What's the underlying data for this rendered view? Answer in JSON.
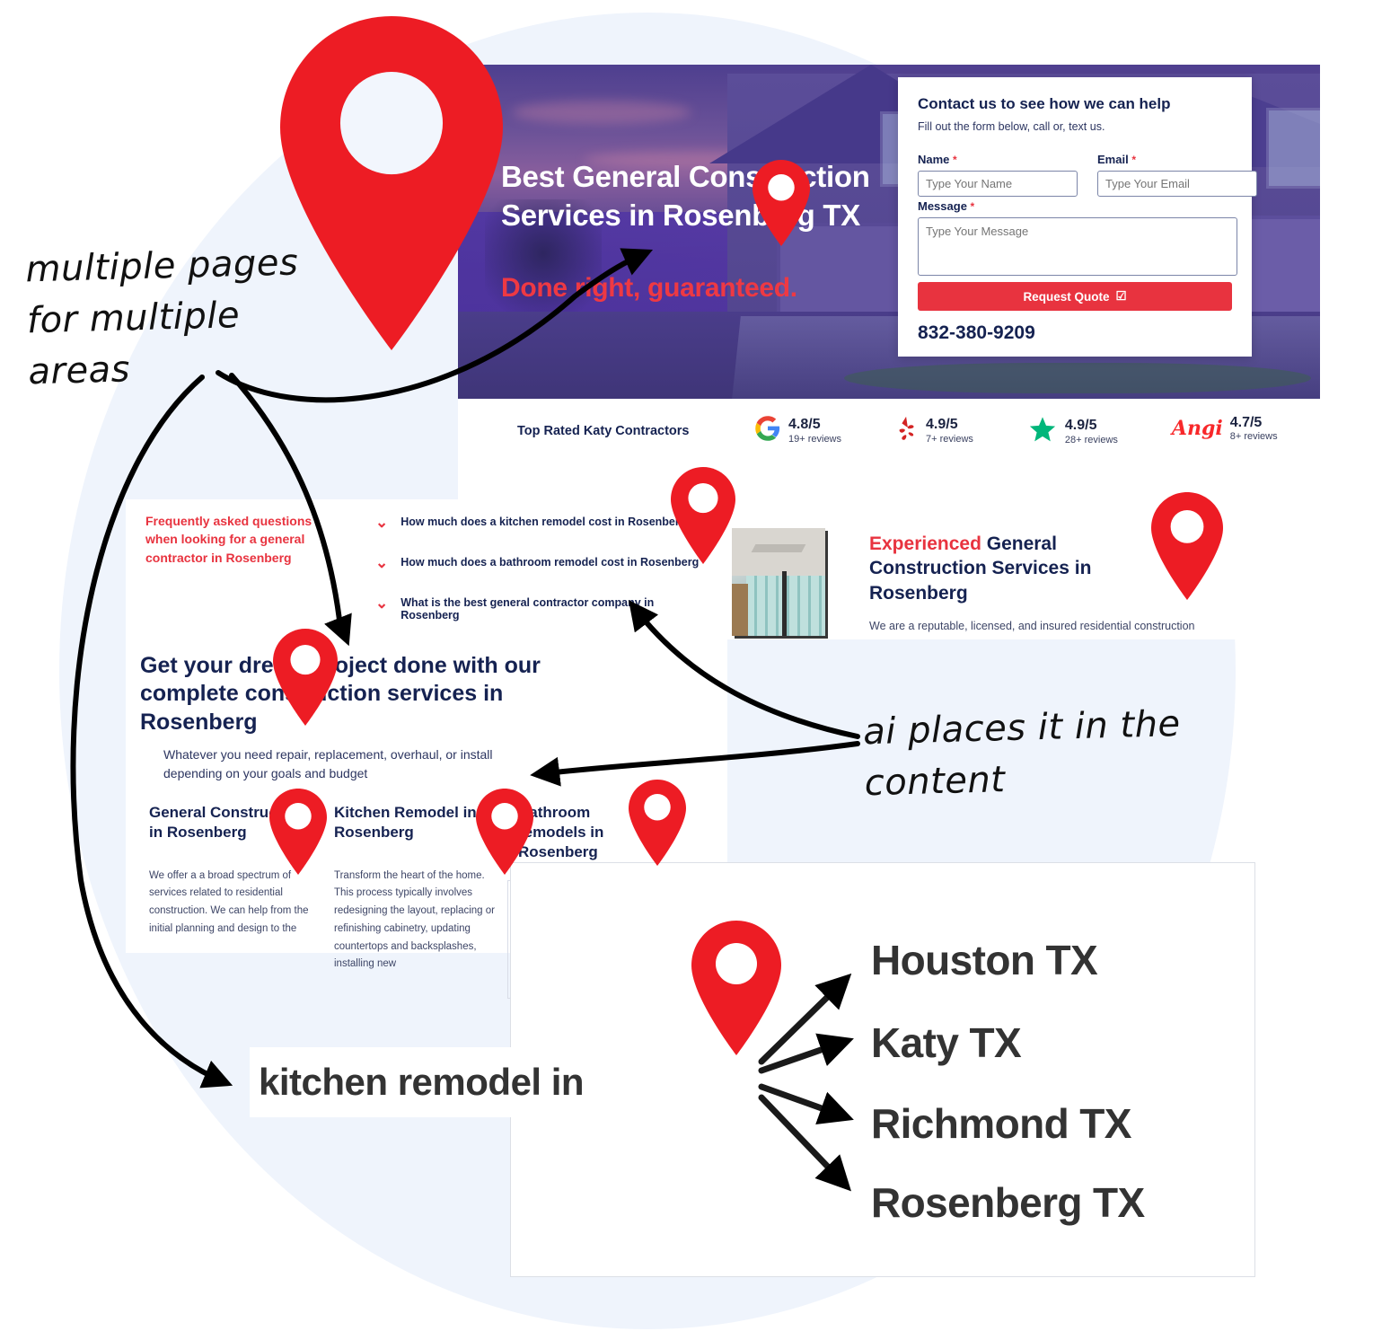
{
  "hero": {
    "title": "Best General Construction Services in Rosenberg TX",
    "subtitle": "Done right, guaranteed."
  },
  "form": {
    "title": "Contact us to see how we can help",
    "subtitle": "Fill out the form below, call or, text us.",
    "name_label": "Name",
    "name_placeholder": "Type Your Name",
    "email_label": "Email",
    "email_placeholder": "Type Your Email",
    "message_label": "Message",
    "message_placeholder": "Type Your Message",
    "required_mark": "*",
    "submit_label": "Request Quote",
    "submit_icon": "checkbox-icon",
    "phone": "832-380-9209"
  },
  "reviews": {
    "heading": "Top Rated Katy Contractors",
    "items": [
      {
        "platform": "google",
        "icon": "google-g-icon",
        "score": "4.8/5",
        "count": "19+ reviews"
      },
      {
        "platform": "yelp",
        "icon": "yelp-burst-icon",
        "score": "4.9/5",
        "count": "7+ reviews"
      },
      {
        "platform": "star",
        "icon": "green-star-icon",
        "score": "4.9/5",
        "count": "28+ reviews"
      },
      {
        "platform": "angi",
        "icon": "angi-wordmark-icon",
        "score": "4.7/5",
        "count": "8+ reviews"
      }
    ]
  },
  "faq": {
    "heading": "Frequently asked questions when looking for a general contractor in Rosenberg",
    "questions": [
      "How much does a kitchen remodel cost in Rosenberg",
      "How much does a bathroom remodel cost in Rosenberg",
      "What is the best general contractor company in Rosenberg"
    ]
  },
  "experienced": {
    "highlight": "Experienced",
    "rest": " General Construction Services in Rosenberg",
    "body": "We are a reputable, licensed, and insured residential construction"
  },
  "dream": {
    "title": "Get your dream project done with our complete construction services in Rosenberg",
    "subtitle": "Whatever you need repair, replacement, overhaul, or install depending on your goals and budget"
  },
  "services": [
    {
      "title": "General Construction in Rosenberg",
      "body": "We offer a a broad spectrum of services related to residential construction. We can help from the initial planning and design to the"
    },
    {
      "title": "Kitchen Remodel in Rosenberg",
      "body": "Transform the heart of the home. This process typically involves redesigning the layout, replacing or refinishing cabinetry, updating countertops and backsplashes, installing new"
    },
    {
      "title": "Bathroom remodels in Rosenberg",
      "body": ""
    }
  ],
  "cities": {
    "keyword": "kitchen remodel in",
    "list": [
      "Houston TX",
      "Katy TX",
      "Richmond TX",
      "Rosenberg TX"
    ]
  },
  "notes": {
    "left": "multiple pages for multiple areas",
    "right": "ai places it in the content"
  },
  "colors": {
    "red": "#e8333f",
    "pin_red": "#ed1c24",
    "navy": "#152251",
    "bg_blue": "#eff4fc",
    "dark_gray": "#333333"
  }
}
